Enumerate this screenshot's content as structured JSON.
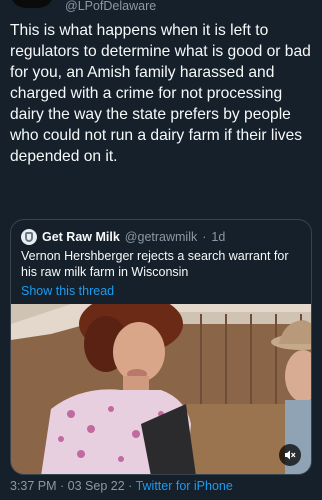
{
  "tweet": {
    "author_handle": "@LPofDelaware",
    "text": "This is what happens when it is left to regulators to determine what is good or bad for you, an Amish family harassed and charged with a crime for not processing dairy the way the state prefers by people who could not run a dairy farm if their lives depended on it.",
    "time": "3:37 PM",
    "date": "03 Sep 22",
    "client": "Twitter for iPhone",
    "separator": " · "
  },
  "quote": {
    "author_name": "Get Raw Milk",
    "author_handle": "@getrawmilk",
    "age": "1d",
    "meta_separator": " · ",
    "text": "Vernon Hershberger rejects a search warrant for his raw milk farm in Wisconsin",
    "show_thread_label": "Show this thread"
  },
  "icons": {
    "mute": "speaker-muted-icon",
    "quote_avatar": "milk-jug-avatar"
  },
  "colors": {
    "background": "#15202b",
    "accent": "#1d9bf0",
    "muted_text": "#8b98a5",
    "border": "#38444d"
  }
}
